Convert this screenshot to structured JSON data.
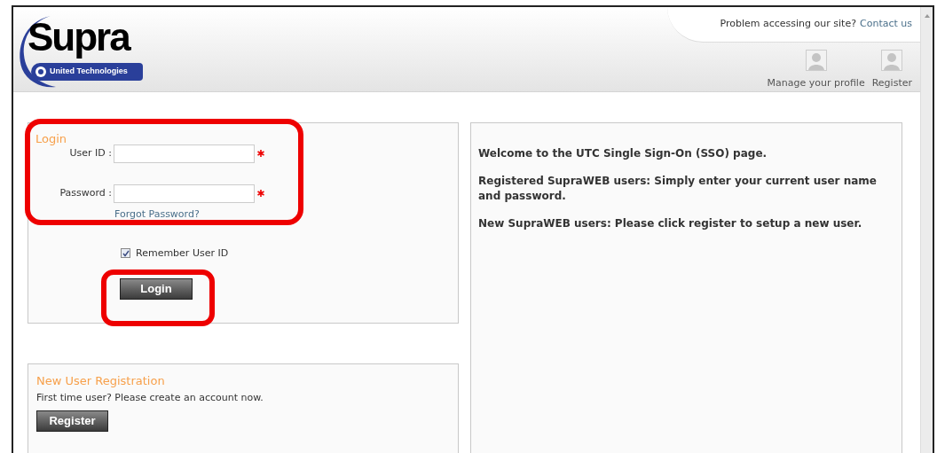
{
  "header": {
    "logo": {
      "wordmark": "Supra",
      "tagline": "United Technologies"
    },
    "help_text": "Problem accessing our site?",
    "help_link": "Contact us",
    "links": [
      {
        "label": "Manage your profile"
      },
      {
        "label": "Register"
      }
    ]
  },
  "login": {
    "title": "Login",
    "fields": [
      {
        "label": "User ID :",
        "required": true
      },
      {
        "label": "Password :",
        "required": true
      }
    ],
    "forgot_link": "Forgot Password?",
    "remember": {
      "label": "Remember User ID",
      "checked": true
    },
    "button": "Login"
  },
  "registration": {
    "title": "New User Registration",
    "text": "First time user? Please create an account now.",
    "button": "Register"
  },
  "welcome": {
    "paragraphs": [
      "Welcome to the UTC Single Sign-On (SSO) page.",
      "Registered SupraWEB users: Simply enter your current user name and password.",
      "New SupraWEB users: Please click register to setup a new user."
    ]
  }
}
